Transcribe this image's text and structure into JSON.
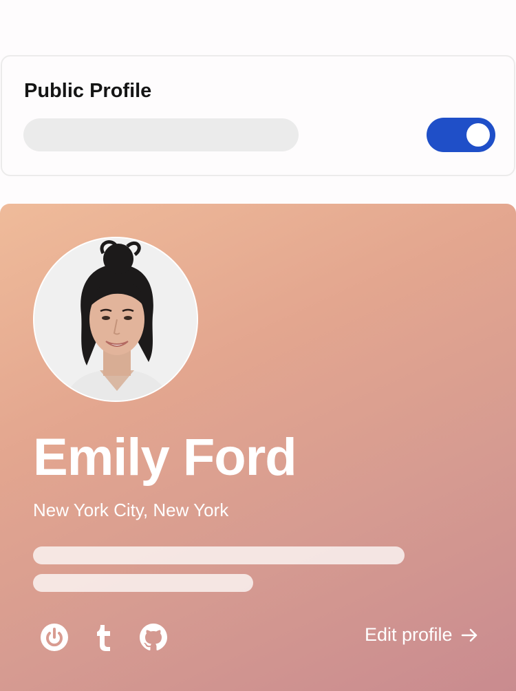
{
  "settings": {
    "title": "Public Profile",
    "public_enabled": true,
    "toggle_color": "#1f4fc8"
  },
  "profile": {
    "name": "Emily Ford",
    "location": "New York City, New York",
    "avatar_icon": "avatar-photo",
    "gradient_colors": [
      "#efbb9a",
      "#c98b8f"
    ],
    "social_links": [
      {
        "icon": "power-icon"
      },
      {
        "icon": "tumblr-icon"
      },
      {
        "icon": "github-icon"
      }
    ],
    "edit_label": "Edit profile"
  }
}
